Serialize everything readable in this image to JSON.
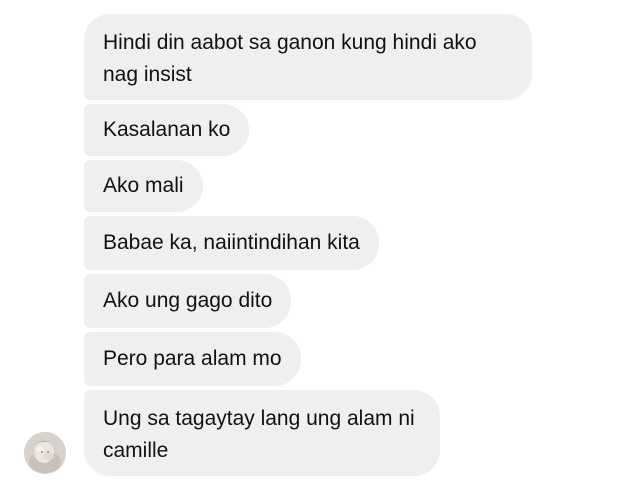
{
  "messages": [
    "Hindi din aabot sa ganon kung hindi ako nag insist",
    "Kasalanan ko",
    "Ako mali",
    "Babae ka, naiintindihan kita",
    "Ako ung gago dito",
    "Pero para alam mo",
    "Ung sa tagaytay lang ung alam ni camille"
  ],
  "colors": {
    "bubble_background": "#efefef",
    "bubble_text": "#111111",
    "page_background": "#ffffff"
  },
  "icons": {
    "avatar": "user-avatar"
  }
}
